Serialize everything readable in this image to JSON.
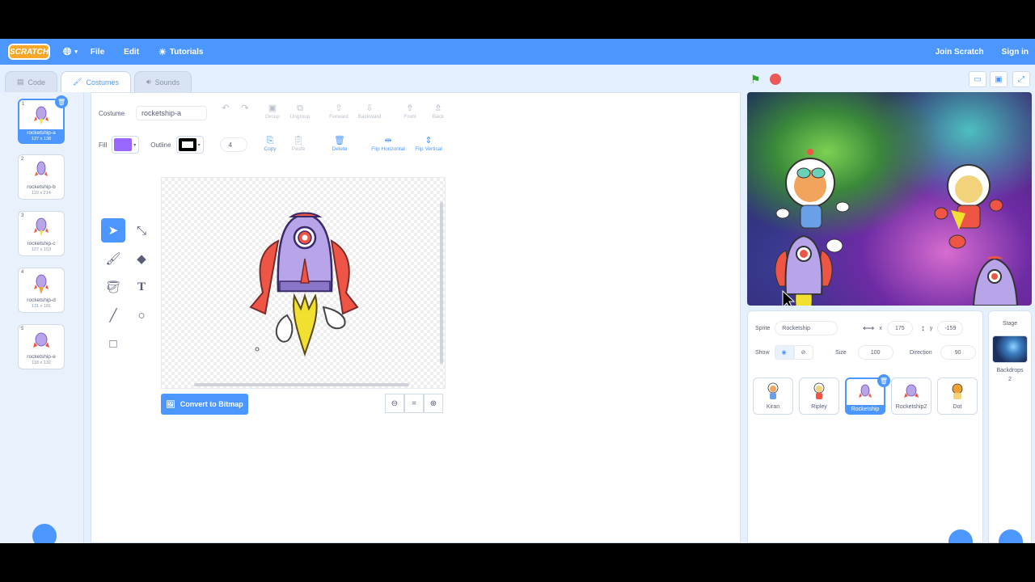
{
  "menubar": {
    "logo": "SCRATCH",
    "file": "File",
    "edit": "Edit",
    "tutorials": "Tutorials",
    "join": "Join Scratch",
    "signin": "Sign in"
  },
  "tabs": {
    "code": "Code",
    "costumes": "Costumes",
    "sounds": "Sounds"
  },
  "costumes": [
    {
      "num": "1",
      "name": "rocketship-a",
      "size": "127 x 138"
    },
    {
      "num": "2",
      "name": "rocketship-b",
      "size": "110 x 214"
    },
    {
      "num": "3",
      "name": "rocketship-c",
      "size": "127 x 153"
    },
    {
      "num": "4",
      "name": "rocketship-d",
      "size": "131 x 181"
    },
    {
      "num": "5",
      "name": "rocketship-e",
      "size": "118 x 132"
    }
  ],
  "paint": {
    "costume_label": "Costume",
    "costume_name": "rocketship-a",
    "group": "Group",
    "ungroup": "Ungroup",
    "forward": "Forward",
    "backward": "Backward",
    "front": "Front",
    "back": "Back",
    "fill_label": "Fill",
    "outline_label": "Outline",
    "outline_width": "4",
    "copy": "Copy",
    "paste": "Paste",
    "delete": "Delete",
    "flip_h": "Flip Horizontal",
    "flip_v": "Flip Vertical",
    "convert": "Convert to Bitmap",
    "zoom_reset": "="
  },
  "colors": {
    "fill": "#9966ff",
    "outline": "#000000",
    "accent": "#4c97ff"
  },
  "sprite": {
    "label": "Sprite",
    "name": "Rocketship",
    "x_label": "x",
    "x": "175",
    "y_label": "y",
    "y": "-159",
    "show_label": "Show",
    "size_label": "Size",
    "size": "100",
    "direction_label": "Direction",
    "direction": "90"
  },
  "sprites": [
    {
      "name": "Kiran"
    },
    {
      "name": "Ripley"
    },
    {
      "name": "Rocketship"
    },
    {
      "name": "Rocketship2"
    },
    {
      "name": "Dot"
    }
  ],
  "stage_panel": {
    "title": "Stage",
    "backdrops_label": "Backdrops",
    "backdrops_count": "2"
  }
}
